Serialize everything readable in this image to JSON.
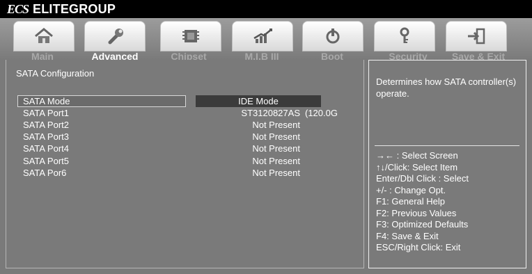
{
  "brand": {
    "mark": "ECS",
    "name": "ELITEGROUP"
  },
  "tabs": [
    {
      "label": "Main",
      "icon": "home-icon",
      "active": false
    },
    {
      "label": "Advanced",
      "icon": "wrench-icon",
      "active": true
    },
    {
      "label": "Chipset",
      "icon": "chip-icon",
      "active": false
    },
    {
      "label": "M.I.B III",
      "icon": "chart-icon",
      "active": false
    },
    {
      "label": "Boot",
      "icon": "power-icon",
      "active": false
    },
    {
      "label": "Security",
      "icon": "key-icon",
      "active": false
    },
    {
      "label": "Save & Exit",
      "icon": "exit-icon",
      "active": false
    }
  ],
  "main": {
    "title": "SATA Configuration",
    "rows": [
      {
        "label": "SATA Mode",
        "value": "IDE Mode",
        "extra": ""
      },
      {
        "label": "SATA Port1",
        "value": "ST3120827AS",
        "extra": "(120.0G"
      },
      {
        "label": "SATA Port2",
        "value": "Not Present",
        "extra": ""
      },
      {
        "label": "SATA Port3",
        "value": "Not Present",
        "extra": ""
      },
      {
        "label": "SATA Port4",
        "value": "Not Present",
        "extra": ""
      },
      {
        "label": "SATA Port5",
        "value": "Not Present",
        "extra": ""
      },
      {
        "label": "SATA Por6",
        "value": "Not Present",
        "extra": ""
      }
    ]
  },
  "help": {
    "description": "Determines how SATA controller(s) operate.",
    "keys": [
      "→← : Select Screen",
      "↑↓/Click: Select Item",
      "Enter/Dbl Click : Select",
      "+/- : Change Opt.",
      "F1: General Help",
      "F2: Previous Values",
      "F3: Optimized Defaults",
      "F4: Save & Exit",
      "ESC/Right Click: Exit"
    ]
  },
  "colors": {
    "topbar": "#000000",
    "panel": "#7a7a7a",
    "highlight": "#3b3b3b",
    "text": "#ffffff",
    "inactive_tab_text": "#a9a9a9"
  }
}
